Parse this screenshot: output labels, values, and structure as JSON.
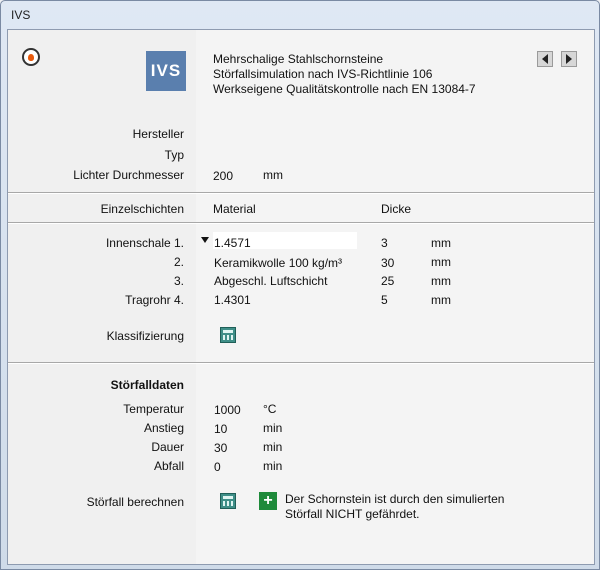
{
  "window": {
    "title": "IVS"
  },
  "header": {
    "logo_text": "IVS",
    "lines": [
      "Mehrschalige Stahlschornsteine",
      "Störfallsimulation nach IVS-Richtlinie 106",
      "Werkseigene Qualitätskontrolle nach EN 13084-7"
    ]
  },
  "general": {
    "hersteller_label": "Hersteller",
    "typ_label": "Typ",
    "durchmesser_label": "Lichter Durchmesser",
    "durchmesser_value": "200",
    "durchmesser_unit": "mm"
  },
  "layers": {
    "section_label": "Einzelschichten",
    "material_header": "Material",
    "dicke_header": "Dicke",
    "rows": [
      {
        "label": "Innenschale 1.",
        "material": "1.4571",
        "dicke": "3",
        "unit": "mm"
      },
      {
        "label": "2.",
        "material": "Keramikwolle 100 kg/m³",
        "dicke": "30",
        "unit": "mm"
      },
      {
        "label": "3.",
        "material": "Abgeschl. Luftschicht",
        "dicke": "25",
        "unit": "mm"
      },
      {
        "label": "Tragrohr 4.",
        "material": "1.4301",
        "dicke": "5",
        "unit": "mm"
      }
    ],
    "klassifizierung_label": "Klassifizierung"
  },
  "stoerfall": {
    "section_label": "Störfalldaten",
    "rows": [
      {
        "label": "Temperatur",
        "value": "1000",
        "unit": "°C"
      },
      {
        "label": "Anstieg",
        "value": "10",
        "unit": "min"
      },
      {
        "label": "Dauer",
        "value": "30",
        "unit": "min"
      },
      {
        "label": "Abfall",
        "value": "0",
        "unit": "min"
      }
    ],
    "berechnen_label": "Störfall berechnen",
    "result_line1": "Der Schornstein ist durch den simulierten",
    "result_line2": "Störfall NICHT gefährdet."
  },
  "icons": [
    "fire-icon",
    "nav-prev-icon",
    "nav-next-icon",
    "calculator-icon",
    "plus-icon",
    "dropdown-icon"
  ],
  "colors": {
    "logo_bg": "#5a7fae",
    "status_green": "#1e8a3a",
    "calc_teal": "#3f8f88"
  }
}
